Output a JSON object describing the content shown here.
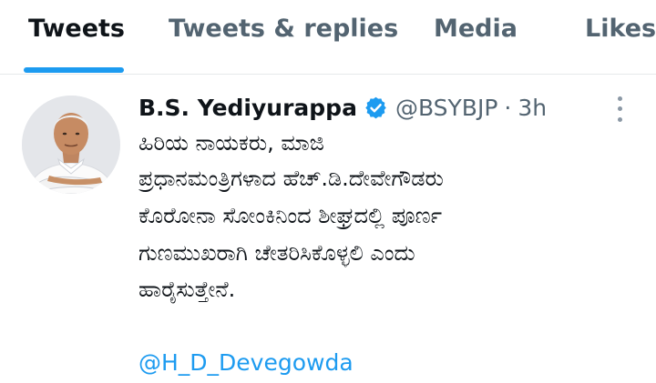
{
  "tabs": {
    "tweets": "Tweets",
    "replies": "Tweets & replies",
    "media": "Media",
    "likes": "Likes"
  },
  "tweet": {
    "author_name": "B.S. Yediyurappa",
    "handle": "@BSYBJP",
    "separator": "·",
    "time": "3h",
    "verified_icon": "verified-badge-icon",
    "more_icon": "more-vertical-icon",
    "lines": [
      "ಹಿರಿಯ ನಾಯಕರು, ಮಾಜಿ",
      "ಪ್ರಧಾನಮಂತ್ರಿಗಳಾದ ಹೆಚ್.ಡಿ.ದೇವೇಗೌಡರು",
      "ಕೊರೋನಾ ಸೋಂಕಿನಿಂದ ಶೀಘ್ರದಲ್ಲಿ ಪೂರ್ಣ",
      "ಗುಣಮುಖರಾಗಿ ಚೇತರಿಸಿಕೊಳ್ಳಲಿ ಎಂದು",
      "ಹಾರೈಸುತ್ತೇನೆ."
    ],
    "mention": "@H_D_Devegowda"
  },
  "colors": {
    "accent": "#1d9bf0",
    "text_primary": "#0f1419",
    "text_secondary": "#536471",
    "divider": "#e6e9eb"
  }
}
